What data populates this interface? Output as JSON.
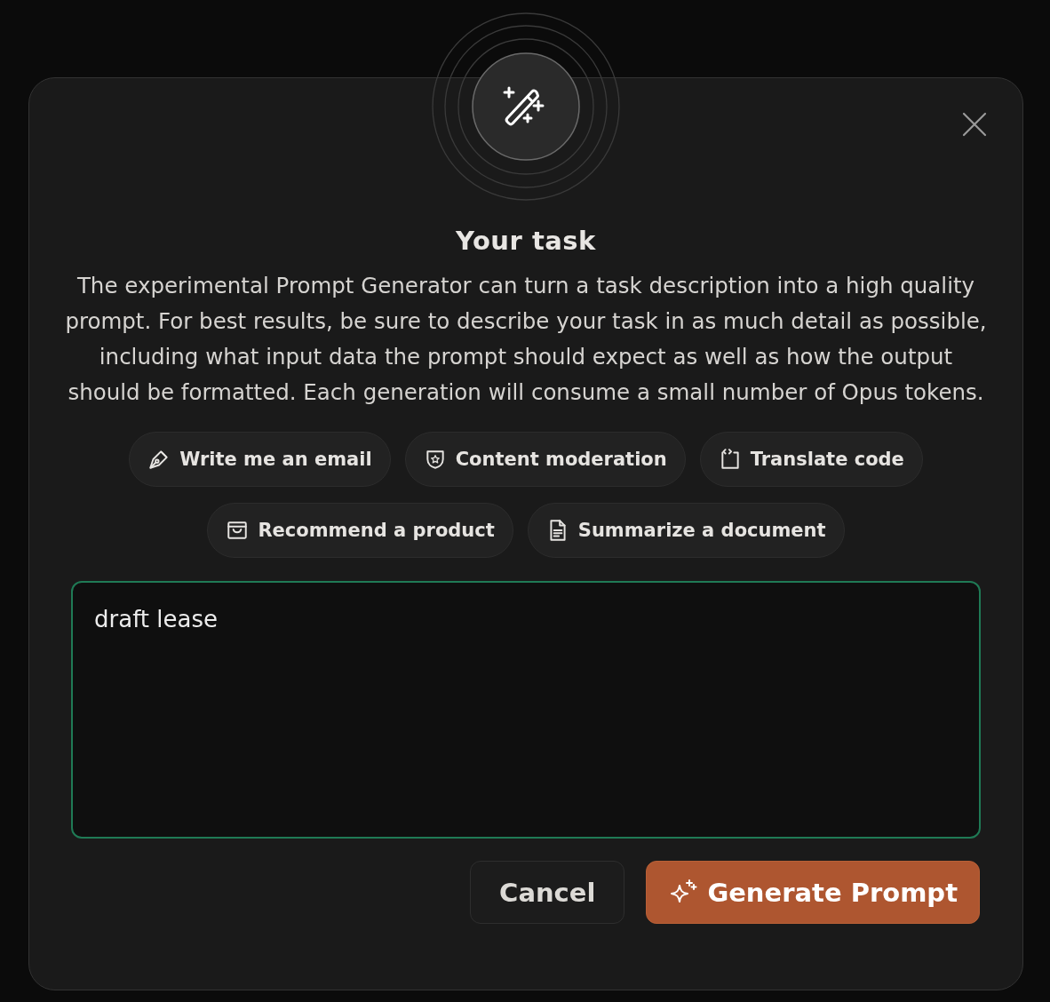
{
  "dialog": {
    "title": "Your task",
    "description": "The experimental Prompt Generator can turn a task description into a high quality prompt. For best results, be sure to describe your task in as much detail as possible, including what input data the prompt should expect as well as how the output should be formatted. Each generation will consume a small number of Opus tokens.",
    "suggestions": [
      {
        "label": "Write me an email",
        "kind": "pen"
      },
      {
        "label": "Content moderation",
        "kind": "shield"
      },
      {
        "label": "Translate code",
        "kind": "code"
      },
      {
        "label": "Recommend a product",
        "kind": "bag"
      },
      {
        "label": "Summarize a document",
        "kind": "doc"
      }
    ],
    "task_field": {
      "value": "draft lease"
    },
    "buttons": [
      {
        "label": "Cancel",
        "kind": "secondary"
      },
      {
        "label": "Generate Prompt",
        "kind": "primary"
      }
    ]
  }
}
